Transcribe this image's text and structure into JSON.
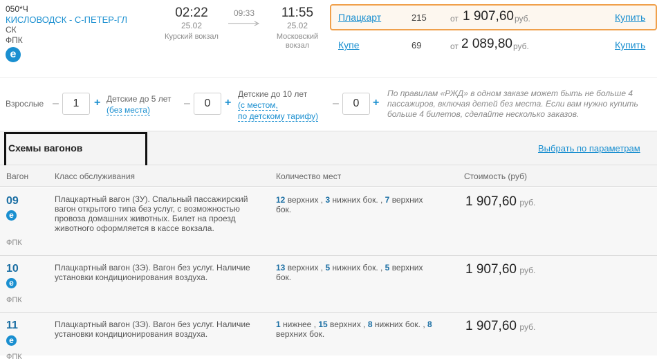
{
  "train": {
    "number": "050*Ч",
    "route": "КИСЛОВОДСК - С-ПЕТЕР-ГЛ",
    "route_suffix": "СК",
    "carrier": "ФПК",
    "eticket_icon": "e"
  },
  "departure": {
    "time": "02:22",
    "date": "25.02",
    "station": "Курский вокзал"
  },
  "travel_time": "09:33",
  "arrival": {
    "time": "11:55",
    "date": "25.02",
    "station_line1": "Московский",
    "station_line2": "вокзал"
  },
  "fares": [
    {
      "class": "Плацкарт",
      "seats": "215",
      "from": "от",
      "price": "1 907,60",
      "currency": "руб.",
      "buy": "Купить"
    },
    {
      "class": "Купе",
      "seats": "69",
      "from": "от",
      "price": "2 089,80",
      "currency": "руб.",
      "buy": "Купить"
    }
  ],
  "passengers": {
    "adults_label": "Взрослые",
    "adults_value": "1",
    "kids5_label": "Детские до 5 лет",
    "kids5_sub": "(без места)",
    "kids5_value": "0",
    "kids10_label": "Детские до 10 лет",
    "kids10_sub1": "(с местом,",
    "kids10_sub2": "по детскому тарифу)",
    "kids10_value": "0",
    "minus": "–",
    "plus": "+",
    "note_line1": "По правилам «РЖД» в одном заказе может быть не больше 4",
    "note_line2": "пассажиров, включая детей без места. Если вам нужно купить",
    "note_line3": "больше 4 билетов, сделайте несколько заказов."
  },
  "schemes": {
    "title": "Схемы вагонов",
    "filter_link": "Выбрать по параметрам",
    "columns": {
      "car": "Вагон",
      "class": "Класс обслуживания",
      "seats": "Количество мест",
      "cost": "Стоимость (руб)"
    }
  },
  "cars": [
    {
      "number": "09",
      "carrier": "ФПК",
      "desc_lines": [
        "Плацкартный вагон (3У). Спальный пассажирский",
        "вагон открытого типа без услуг, с возможностью",
        "провоза домашних животных. Билет на проезд",
        "животного оформляется в кассе вокзала."
      ],
      "seat_parts": [
        {
          "n": "12",
          "t": " верхних , "
        },
        {
          "n": "3",
          "t": " нижних бок. , "
        },
        {
          "n": "7",
          "t": " верхних"
        }
      ],
      "seat_tail": "бок.",
      "price": "1 907,60",
      "currency": "руб."
    },
    {
      "number": "10",
      "carrier": "ФПК",
      "desc_lines": [
        "Плацкартный вагон (3Э). Вагон без услуг. Наличие",
        "установки кондиционирования воздуха."
      ],
      "seat_parts": [
        {
          "n": "13",
          "t": " верхних , "
        },
        {
          "n": "5",
          "t": " нижних бок. , "
        },
        {
          "n": "5",
          "t": " верхних"
        }
      ],
      "seat_tail": "бок.",
      "price": "1 907,60",
      "currency": "руб."
    },
    {
      "number": "11",
      "carrier": "ФПК",
      "desc_lines": [
        "Плацкартный вагон (3Э). Вагон без услуг. Наличие",
        "установки кондиционирования воздуха."
      ],
      "seat_parts": [
        {
          "n": "1",
          "t": " нижнее , "
        },
        {
          "n": "15",
          "t": " верхних , "
        },
        {
          "n": "8",
          "t": " нижних бок. , "
        },
        {
          "n": "8",
          "t": ""
        }
      ],
      "seat_tail": "верхних бок.",
      "price": "1 907,60",
      "currency": "руб."
    }
  ],
  "colors": {
    "accent": "#1a8fd0",
    "highlight_border": "#f0a04b"
  }
}
